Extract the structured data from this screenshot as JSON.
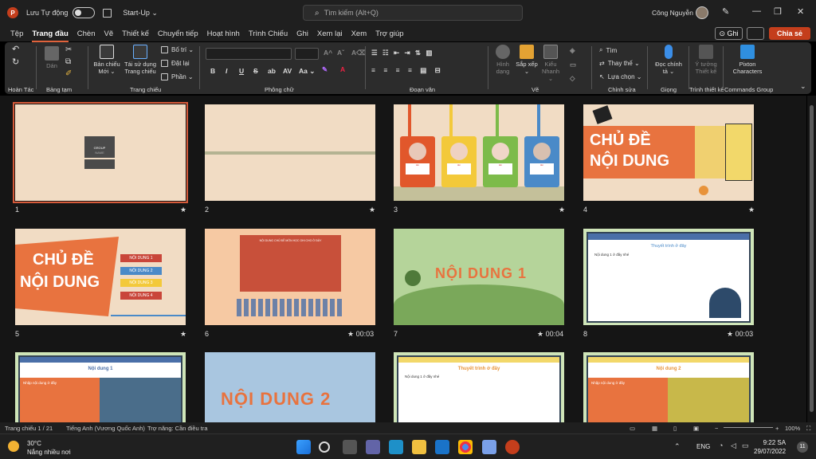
{
  "titlebar": {
    "app_icon": "P",
    "autosave_label": "Lưu Tự động",
    "filename": "Start-Up ⌄",
    "search_placeholder": "Tìm kiếm (Alt+Q)",
    "user_name": "Công Nguyễn"
  },
  "menu": {
    "tabs": [
      "Tệp",
      "Trang đầu",
      "Chèn",
      "Vẽ",
      "Thiết kế",
      "Chuyển tiếp",
      "Hoạt hình",
      "Trình Chiếu",
      "Ghi",
      "Xem lại",
      "Xem",
      "Trợ giúp"
    ],
    "record_label": "Ghi",
    "share_label": "Chia sẻ"
  },
  "ribbon": {
    "undo_group": "Hoàn Tác",
    "clipboard": {
      "paste": "Dán",
      "group": "Bảng tạm"
    },
    "slides": {
      "new_slide": "Bản chiếu Mới ⌄",
      "reuse": "Tái sử dụng Trang chiếu",
      "layout": "Bố trí ⌄",
      "reset": "Đặt lại",
      "section": "Phần ⌄",
      "group": "Trang chiếu"
    },
    "font": {
      "bold": "B",
      "italic": "I",
      "underline": "U",
      "strike": "S",
      "shadow": "ab",
      "spacing": "AV",
      "case": "Aa ⌄",
      "group": "Phông chữ"
    },
    "paragraph": {
      "group": "Đoạn văn"
    },
    "drawing": {
      "shapes": "Hình dạng",
      "arrange": "Sắp xếp ⌄",
      "styles": "Kiểu Nhanh ⌄",
      "group": "Vẽ"
    },
    "editing": {
      "find": "Tìm",
      "replace": "Thay thế ⌄",
      "select": "Lựa chọn ⌄",
      "group": "Chỉnh sửa"
    },
    "voice": {
      "dictate": "Đọc chính tả ⌄",
      "group": "Giọng"
    },
    "designer": {
      "ideas": "Ý tưởng Thiết kế",
      "group": "Trình thiết kế"
    },
    "commands": {
      "pixton": "Pixton Characters",
      "group": "Commands Group"
    }
  },
  "slides": [
    {
      "num": "1",
      "time": "",
      "star": "★"
    },
    {
      "num": "2",
      "time": "",
      "star": "★"
    },
    {
      "num": "3",
      "time": "",
      "star": "★"
    },
    {
      "num": "4",
      "time": "",
      "star": "★"
    },
    {
      "num": "5",
      "time": "",
      "star": "★"
    },
    {
      "num": "6",
      "time": "00:03",
      "star": "★"
    },
    {
      "num": "7",
      "time": "00:04",
      "star": "★"
    },
    {
      "num": "8",
      "time": "00:03",
      "star": "★"
    }
  ],
  "slide_text": {
    "s1_group": "GROUP",
    "s1_name": "NAME",
    "s3_badge": "tên",
    "s4_line1": "CHỦ ĐỀ",
    "s4_line2": "NỘI DUNG",
    "s5_line1": "CHỦ ĐỀ",
    "s5_line2": "NỘI DUNG",
    "s5_items": [
      "NỘI DUNG 1",
      "NỘI DUNG 2",
      "NỘI DUNG 3",
      "NỘI DUNG 4"
    ],
    "s6_text": "NỘI DUNG CHỦ ĐỀ MÔN HỌC GHI CHO Ở ĐÂY",
    "s7_text": "NỘI DUNG 1",
    "s8_title": "Thuyết trình ở đây",
    "s8_body": "Nội dung 1 ở đây nhé",
    "s9_title": "Nội dung 1",
    "s9_body": "Nhập nội dung ở đây",
    "s10_text": "NỘI DUNG 2",
    "s11_title": "Thuyết trình ở đây",
    "s11_body": "Nội dung 1 ở đây nhé",
    "s12_title": "Nội dung 2",
    "s12_body": "Nhập nội dung ở đây"
  },
  "status": {
    "slide_info": "Trang chiếu 1 / 21",
    "language": "Tiếng Anh (Vương Quốc Anh)",
    "accessibility": "Trợ năng: Cần điều tra",
    "zoom": "100%"
  },
  "taskbar": {
    "temp": "30°C",
    "weather": "Nắng nhiều nơi",
    "lang": "ENG",
    "time": "9:22 SA",
    "date": "29/07/2022",
    "notif": "11"
  },
  "colors": {
    "accent": "#c43e1c",
    "selection": "#d55a3a",
    "slide_bg": "#f1dcc4"
  }
}
